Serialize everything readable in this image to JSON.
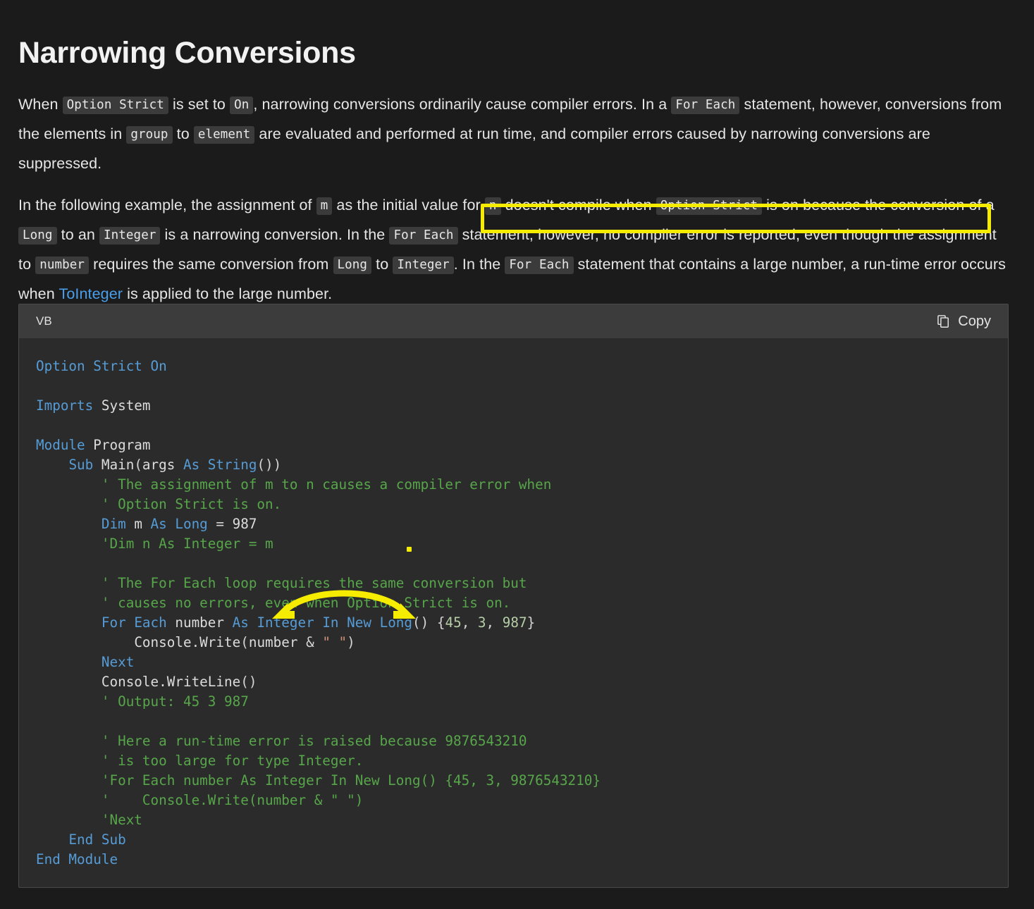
{
  "page": {
    "title": "Narrowing Conversions"
  },
  "paragraphs": {
    "p1": {
      "t1": "When ",
      "c1": "Option Strict",
      "t2": " is set to ",
      "c2": "On",
      "t3": ", narrowing conversions ordinarily cause compiler errors. In a ",
      "c3": "For Each",
      "t4": " statement, however, conversions from the elements in ",
      "c4": "group",
      "t5": " to ",
      "c5": "element",
      "t6": " are evaluated and performed at run time, and compiler errors caused by narrowing conversions are suppressed."
    },
    "p2": {
      "t1": "In the following example, the assignment of ",
      "c1": "m",
      "t2": " as the initial value for ",
      "c2": "n",
      "t3": " doesn't compile when ",
      "c3": "Option Strict",
      "t4": " is on because the conversion of a ",
      "c4": "Long",
      "t5": " to an ",
      "c5": "Integer",
      "t6": " is a narrowing conversion. In the ",
      "c6": "For Each",
      "t7": " statement, however, no compiler error is reported, even though the assignment to ",
      "c7": "number",
      "t8": " requires the same conversion from ",
      "c8": "Long",
      "t9": " to ",
      "c9": "Integer",
      "t10": ". In the ",
      "c10": "For Each",
      "t11": " statement that contains a large number, a run-time error occurs when ",
      "link": "ToInteger",
      "t12": " is applied to the large number."
    }
  },
  "code_block": {
    "language_label": "VB",
    "copy_label": "Copy",
    "copy_icon": "copy-icon",
    "lines": [
      [
        {
          "t": "Option Strict On",
          "c": "kw"
        }
      ],
      [],
      [
        {
          "t": "Imports ",
          "c": "kw"
        },
        {
          "t": "System",
          "c": "id"
        }
      ],
      [],
      [
        {
          "t": "Module ",
          "c": "kw"
        },
        {
          "t": "Program",
          "c": "id"
        }
      ],
      [
        {
          "t": "    ",
          "c": "plain"
        },
        {
          "t": "Sub ",
          "c": "kw"
        },
        {
          "t": "Main",
          "c": "id"
        },
        {
          "t": "(",
          "c": "plain"
        },
        {
          "t": "args ",
          "c": "id"
        },
        {
          "t": "As ",
          "c": "kw"
        },
        {
          "t": "String",
          "c": "kw"
        },
        {
          "t": "())",
          "c": "plain"
        }
      ],
      [
        {
          "t": "        ",
          "c": "plain"
        },
        {
          "t": "' The assignment of m to n causes a compiler error when",
          "c": "cmt"
        }
      ],
      [
        {
          "t": "        ",
          "c": "plain"
        },
        {
          "t": "' Option Strict is on.",
          "c": "cmt"
        }
      ],
      [
        {
          "t": "        ",
          "c": "plain"
        },
        {
          "t": "Dim ",
          "c": "kw"
        },
        {
          "t": "m ",
          "c": "id"
        },
        {
          "t": "As ",
          "c": "kw"
        },
        {
          "t": "Long ",
          "c": "kw"
        },
        {
          "t": "= ",
          "c": "plain"
        },
        {
          "t": "987",
          "c": "id"
        }
      ],
      [
        {
          "t": "        ",
          "c": "plain"
        },
        {
          "t": "'Dim n As Integer = m",
          "c": "cmt"
        }
      ],
      [],
      [
        {
          "t": "        ",
          "c": "plain"
        },
        {
          "t": "' The For Each loop requires the same conversion but",
          "c": "cmt"
        }
      ],
      [
        {
          "t": "        ",
          "c": "plain"
        },
        {
          "t": "' causes no errors, even when Option Strict is on.",
          "c": "cmt"
        }
      ],
      [
        {
          "t": "        ",
          "c": "plain"
        },
        {
          "t": "For ",
          "c": "kw"
        },
        {
          "t": "Each ",
          "c": "kw"
        },
        {
          "t": "number ",
          "c": "id"
        },
        {
          "t": "As ",
          "c": "kw"
        },
        {
          "t": "Integer ",
          "c": "kw"
        },
        {
          "t": "In ",
          "c": "kw"
        },
        {
          "t": "New ",
          "c": "kw"
        },
        {
          "t": "Long",
          "c": "kw"
        },
        {
          "t": "() {",
          "c": "plain"
        },
        {
          "t": "45",
          "c": "num"
        },
        {
          "t": ", ",
          "c": "plain"
        },
        {
          "t": "3",
          "c": "num"
        },
        {
          "t": ", ",
          "c": "plain"
        },
        {
          "t": "987",
          "c": "num"
        },
        {
          "t": "}",
          "c": "plain"
        }
      ],
      [
        {
          "t": "            ",
          "c": "plain"
        },
        {
          "t": "Console.Write",
          "c": "id"
        },
        {
          "t": "(",
          "c": "plain"
        },
        {
          "t": "number ",
          "c": "id"
        },
        {
          "t": "& ",
          "c": "plain"
        },
        {
          "t": "\" \"",
          "c": "str"
        },
        {
          "t": ")",
          "c": "plain"
        }
      ],
      [
        {
          "t": "        ",
          "c": "plain"
        },
        {
          "t": "Next",
          "c": "kw"
        }
      ],
      [
        {
          "t": "        ",
          "c": "plain"
        },
        {
          "t": "Console.WriteLine",
          "c": "id"
        },
        {
          "t": "()",
          "c": "plain"
        }
      ],
      [
        {
          "t": "        ",
          "c": "plain"
        },
        {
          "t": "' Output: 45 3 987",
          "c": "cmt"
        }
      ],
      [],
      [
        {
          "t": "        ",
          "c": "plain"
        },
        {
          "t": "' Here a run-time error is raised because 9876543210",
          "c": "cmt"
        }
      ],
      [
        {
          "t": "        ",
          "c": "plain"
        },
        {
          "t": "' is too large for type Integer.",
          "c": "cmt"
        }
      ],
      [
        {
          "t": "        ",
          "c": "plain"
        },
        {
          "t": "'For Each number As Integer In New Long() {45, 3, 9876543210}",
          "c": "cmt"
        }
      ],
      [
        {
          "t": "        ",
          "c": "plain"
        },
        {
          "t": "'    Console.Write(number & \" \")",
          "c": "cmt"
        }
      ],
      [
        {
          "t": "        ",
          "c": "plain"
        },
        {
          "t": "'Next",
          "c": "cmt"
        }
      ],
      [
        {
          "t": "    ",
          "c": "plain"
        },
        {
          "t": "End Sub",
          "c": "kw"
        }
      ],
      [
        {
          "t": "End Module",
          "c": "kw"
        }
      ]
    ]
  },
  "annotations": {
    "highlight_color": "#f5ec00",
    "arrow_color": "#f5ec00",
    "highlight_text": "In the For Each statement, however, no compiler error is reported,"
  },
  "colors": {
    "page_background": "#1b1b1b",
    "code_background": "#2b2b2b",
    "code_header_background": "#3c3c3c",
    "inline_code_background": "#3b3b3b",
    "link": "#4a9eea",
    "keyword": "#569cd6",
    "comment": "#57a64a",
    "number": "#b5cea8",
    "string": "#ce9178"
  }
}
